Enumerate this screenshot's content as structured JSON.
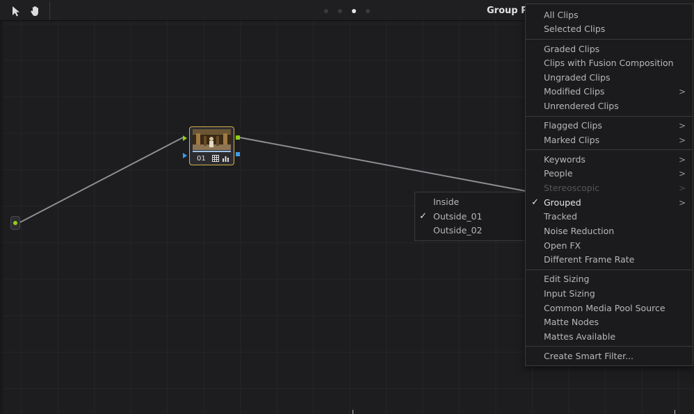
{
  "toolbar": {
    "tools": [
      {
        "icon": "pointer-arrow-icon"
      },
      {
        "icon": "hand-pan-icon"
      }
    ],
    "page_dots": 4,
    "active_dot": 2,
    "title_visible": "Group Po"
  },
  "node_graph": {
    "node": {
      "number": "01"
    }
  },
  "filter_menu": {
    "sections": [
      [
        {
          "label": "All Clips"
        },
        {
          "label": "Selected Clips"
        }
      ],
      [
        {
          "label": "Graded Clips"
        },
        {
          "label": "Clips with Fusion Composition"
        },
        {
          "label": "Ungraded Clips"
        },
        {
          "label": "Modified Clips",
          "submenu": true
        },
        {
          "label": "Unrendered Clips"
        }
      ],
      [
        {
          "label": "Flagged Clips",
          "submenu": true
        },
        {
          "label": "Marked Clips",
          "submenu": true
        }
      ],
      [
        {
          "label": "Keywords",
          "submenu": true
        },
        {
          "label": "People",
          "submenu": true
        },
        {
          "label": "Stereoscopic",
          "submenu": true,
          "disabled": true
        },
        {
          "label": "Grouped",
          "submenu": true,
          "checked": true
        },
        {
          "label": "Tracked"
        },
        {
          "label": "Noise Reduction"
        },
        {
          "label": "Open FX"
        },
        {
          "label": "Different Frame Rate"
        }
      ],
      [
        {
          "label": "Edit Sizing"
        },
        {
          "label": "Input Sizing"
        },
        {
          "label": "Common Media Pool Source"
        },
        {
          "label": "Matte Nodes"
        },
        {
          "label": "Mattes Available"
        }
      ],
      [
        {
          "label": "Create Smart Filter..."
        }
      ]
    ]
  },
  "grouped_submenu": {
    "items": [
      {
        "label": "Inside"
      },
      {
        "label": "Outside_01",
        "checked": true
      },
      {
        "label": "Outside_02"
      }
    ]
  },
  "colors": {
    "accent_green": "#8fd11a",
    "accent_blue": "#3d9be9",
    "node_border": "#d7b14a"
  }
}
